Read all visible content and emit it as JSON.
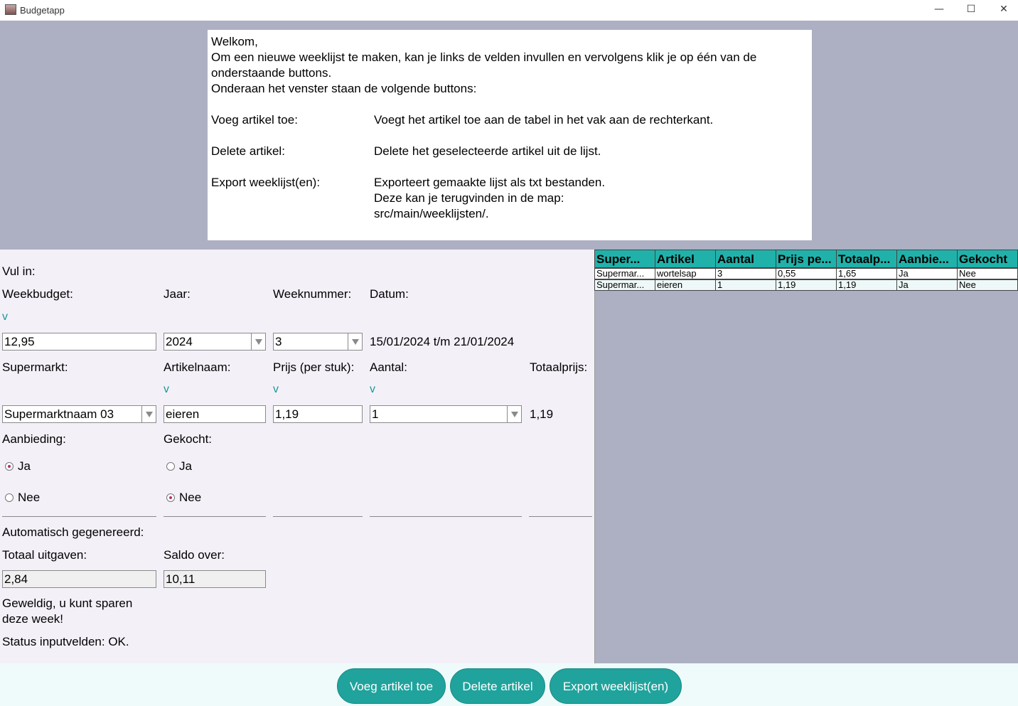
{
  "window": {
    "title": "Budgetapp",
    "minimize": "—",
    "maximize": "☐",
    "close": "✕"
  },
  "info": {
    "lines": [
      "Welkom,",
      "Om een nieuwe weeklijst te maken, kan je links de velden invullen en vervolgens klik je op één van de",
      "onderstaande buttons.",
      "Onderaan het venster staan de volgende buttons:"
    ],
    "rows": [
      {
        "k": "Voeg artikel toe:",
        "v": "Voegt het artikel toe aan de tabel in het vak aan de rechterkant."
      },
      {
        "k": "Delete artikel:",
        "v": "Delete het geselecteerde artikel uit de lijst."
      },
      {
        "k": "Export weeklijst(en):",
        "v": "Exporteert gemaakte lijst als txt bestanden."
      }
    ],
    "extra": [
      "Deze kan je terugvinden in de map:",
      "src/main/weeklijsten/."
    ]
  },
  "form": {
    "vul_in": "Vul in:",
    "weekbudget_label": "Weekbudget:",
    "jaar_label": "Jaar:",
    "weeknummer_label": "Weeknummer:",
    "datum_label": "Datum:",
    "v_marker": "v",
    "weekbudget": "12,95",
    "jaar": "2024",
    "weeknummer": "3",
    "datum": "15/01/2024 t/m 21/01/2024",
    "supermarkt_label": "Supermarkt:",
    "artikelnaam_label": "Artikelnaam:",
    "prijs_label": "Prijs (per stuk):",
    "aantal_label": "Aantal:",
    "totaalprijs_label": "Totaalprijs:",
    "supermarkt": "Supermarktnaam 03",
    "artikelnaam": "eieren",
    "prijs": "1,19",
    "aantal": "1",
    "totaalprijs": "1,19",
    "aanbieding_label": "Aanbieding:",
    "gekocht_label": "Gekocht:",
    "ja": "Ja",
    "nee": "Nee",
    "auto_label": "Automatisch gegenereerd:",
    "totaal_uitgaven_label": "Totaal uitgaven:",
    "saldo_label": "Saldo over:",
    "totaal_uitgaven": "2,84",
    "saldo": "10,11",
    "message_1": "Geweldig, u kunt sparen",
    "message_2": "deze week!",
    "status": "Status inputvelden: OK."
  },
  "table": {
    "headers": [
      "Super...",
      "Artikel",
      "Aantal",
      "Prijs pe...",
      "Totaalp...",
      "Aanbie...",
      "Gekocht"
    ],
    "rows": [
      [
        "Supermar...",
        "wortelsap",
        "3",
        "0,55",
        "1,65",
        "Ja",
        "Nee"
      ],
      [
        "Supermar...",
        "eieren",
        "1",
        "1,19",
        "1,19",
        "Ja",
        "Nee"
      ]
    ]
  },
  "buttons": {
    "add": "Voeg artikel toe",
    "delete": "Delete artikel",
    "export": "Export weeklijst(en)"
  },
  "colors": {
    "accent": "#20a39c",
    "header": "#20b2aa",
    "panel": "#adb0c2"
  }
}
